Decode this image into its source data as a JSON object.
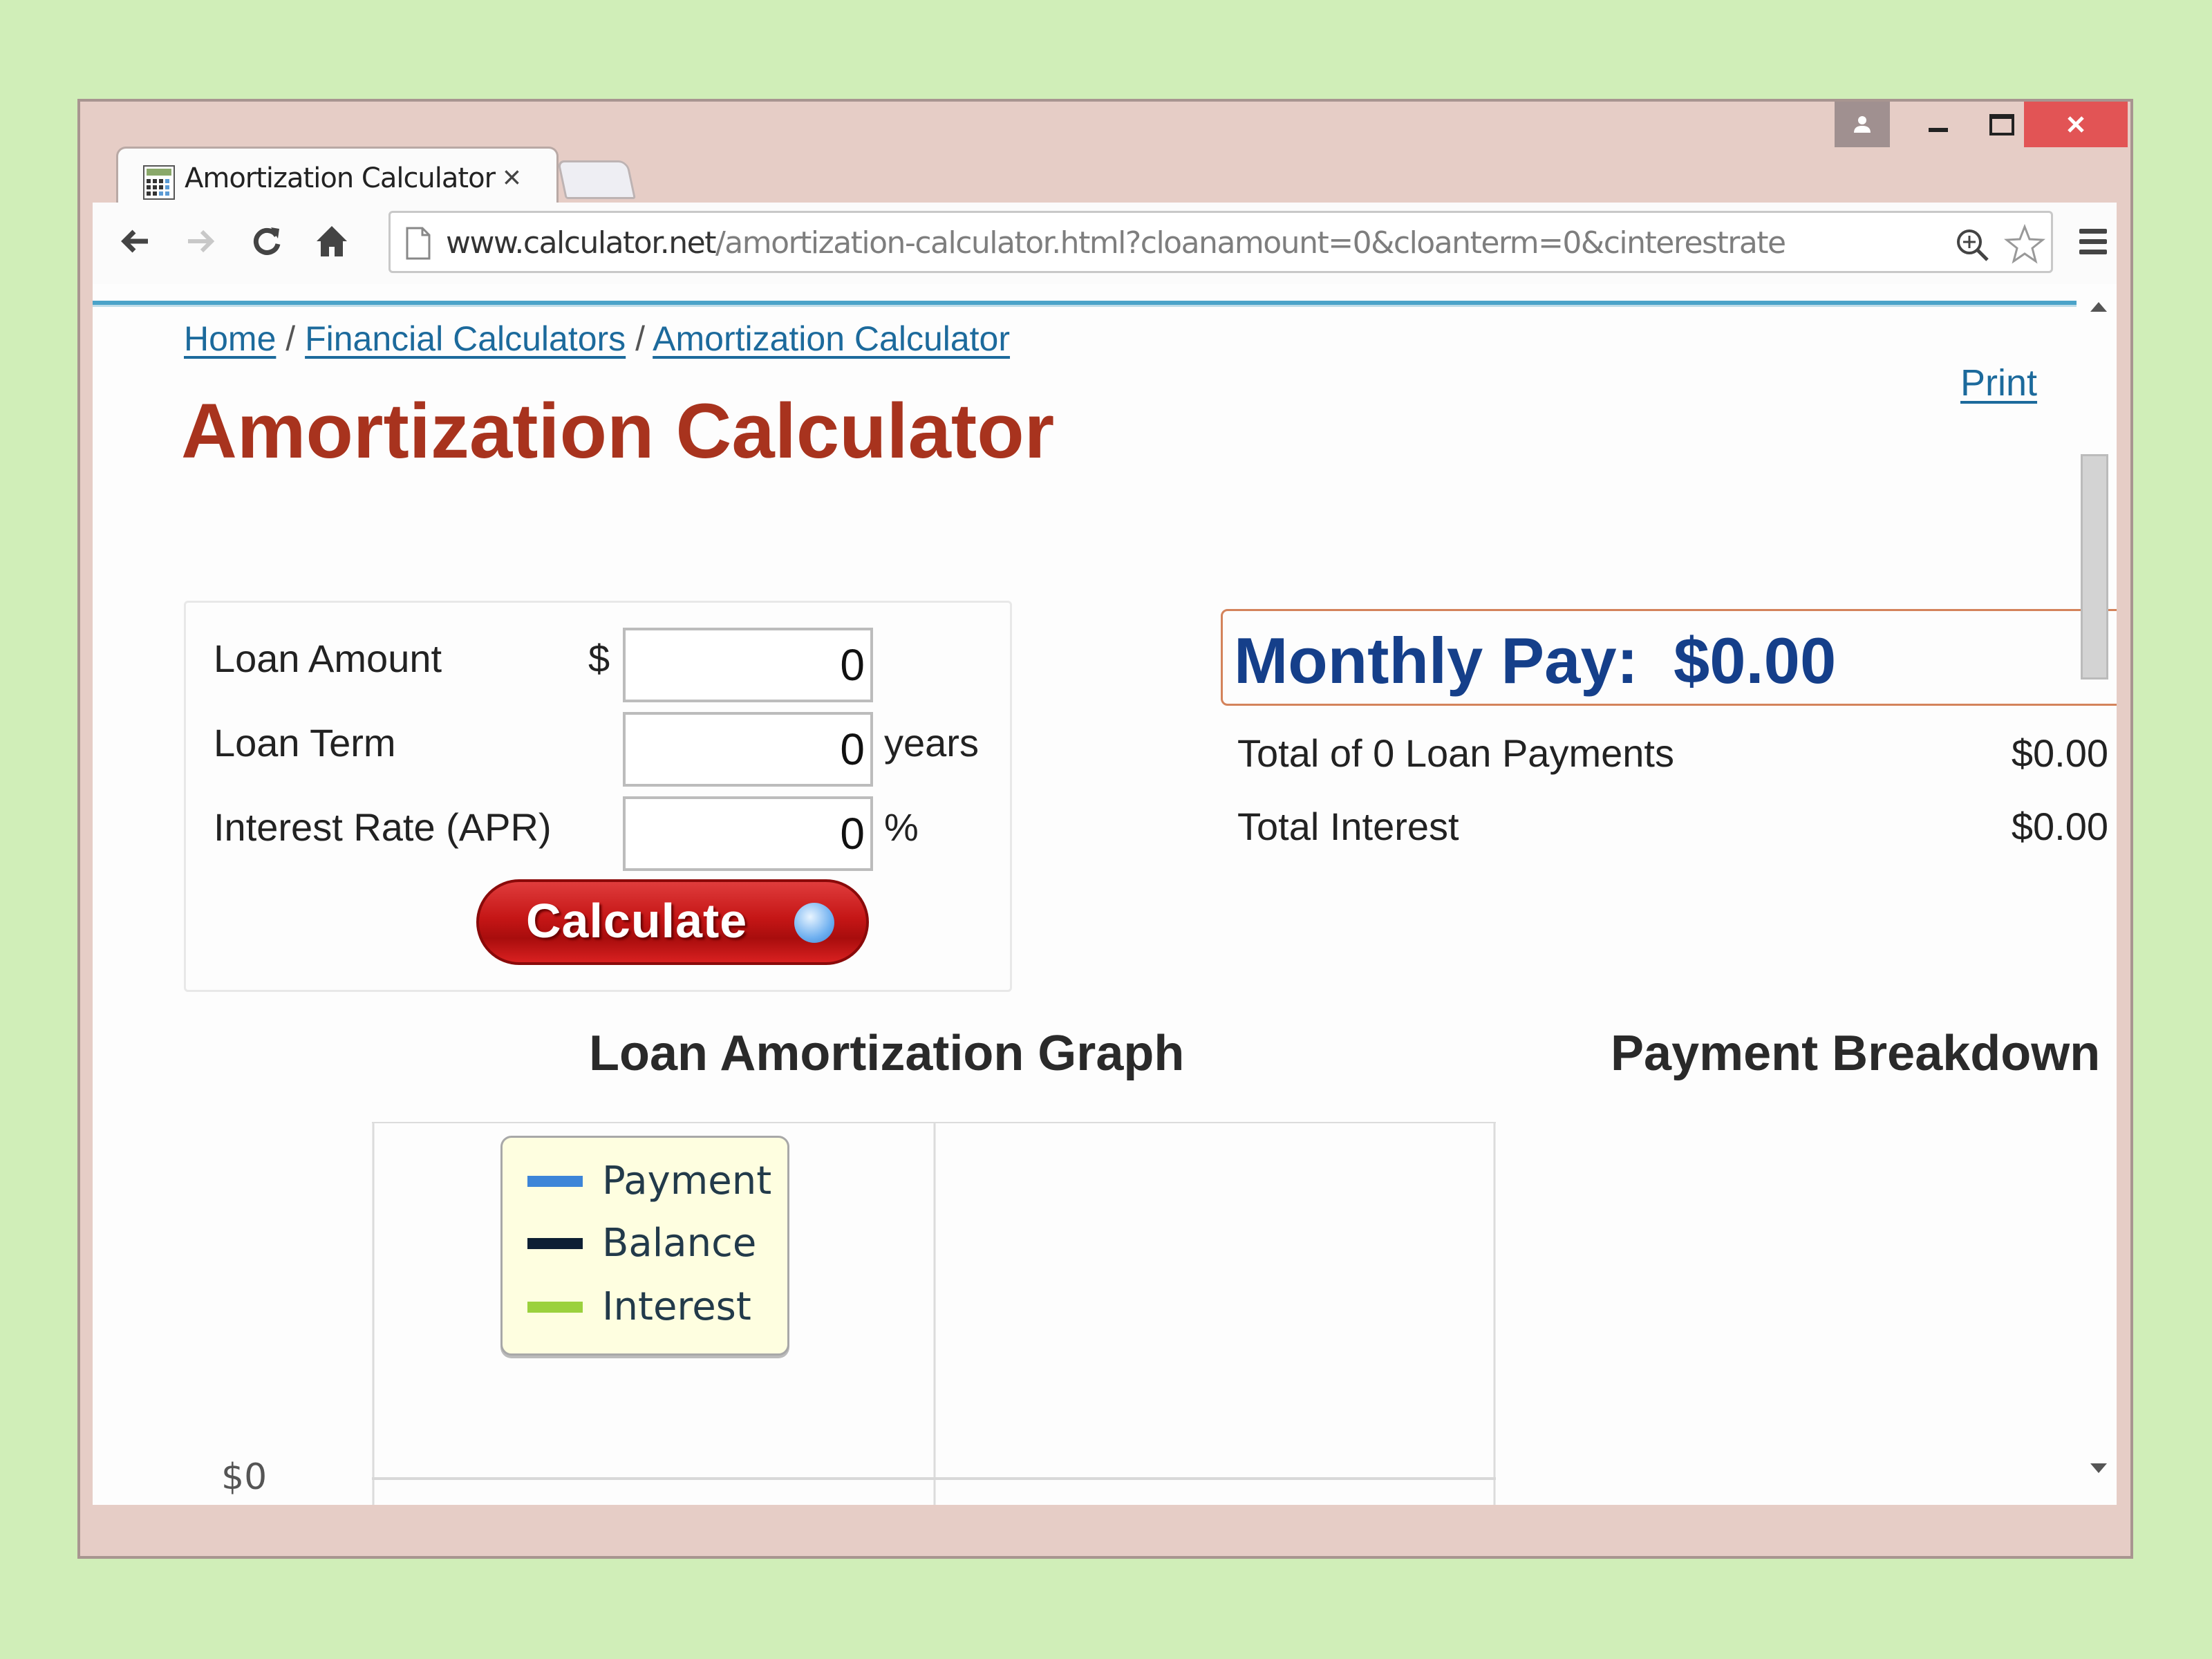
{
  "window": {
    "controls": [
      "user",
      "minimize",
      "maximize",
      "close"
    ],
    "colors": {
      "close": "#e25455",
      "frame": "#e6cdc6",
      "desktop": "#d0eeb8"
    }
  },
  "tab": {
    "title": "Amortization Calculator",
    "close_glyph": "×",
    "icon": "calculator-icon"
  },
  "toolbar": {
    "url_host": "www.calculator.net",
    "url_path": "/amortization-calculator.html?cloanamount=0&cloanterm=0&cinterestrate",
    "icons": [
      "back-icon",
      "forward-icon",
      "reload-icon",
      "home-icon",
      "page-icon",
      "zoom-icon",
      "star-icon",
      "menu-icon"
    ]
  },
  "page": {
    "breadcrumb": [
      {
        "label": "Home"
      },
      {
        "label": "Financial Calculators"
      },
      {
        "label": "Amortization Calculator"
      }
    ],
    "breadcrumb_separator": "/",
    "print_label": "Print",
    "title": "Amortization Calculator",
    "title_color": "#a8331e",
    "form": {
      "loan_amount": {
        "label": "Loan Amount",
        "prefix": "$",
        "value": "0"
      },
      "loan_term": {
        "label": "Loan Term",
        "value": "0",
        "suffix": "years"
      },
      "interest_rate": {
        "label": "Interest Rate (APR)",
        "value": "0",
        "suffix": "%"
      },
      "calculate_label": "Calculate"
    },
    "results": {
      "monthly_label": "Monthly Pay:",
      "monthly_value": "$0.00",
      "rows": [
        {
          "label": "Total of 0 Loan Payments",
          "value": "$0.00"
        },
        {
          "label": "Total Interest",
          "value": "$0.00"
        }
      ],
      "accent_color": "#153f8a"
    },
    "graph_title": "Loan Amortization Graph",
    "breakdown_title": "Payment Breakdown"
  },
  "chart_data": {
    "type": "line",
    "title": "Loan Amortization Graph",
    "series": [
      {
        "name": "Payment",
        "color": "#3d85d8",
        "values": []
      },
      {
        "name": "Balance",
        "color": "#0d1f33",
        "values": []
      },
      {
        "name": "Interest",
        "color": "#9bd13e",
        "values": []
      }
    ],
    "y_ticks": [
      "$0"
    ],
    "legend": "top-left",
    "grid": true
  }
}
